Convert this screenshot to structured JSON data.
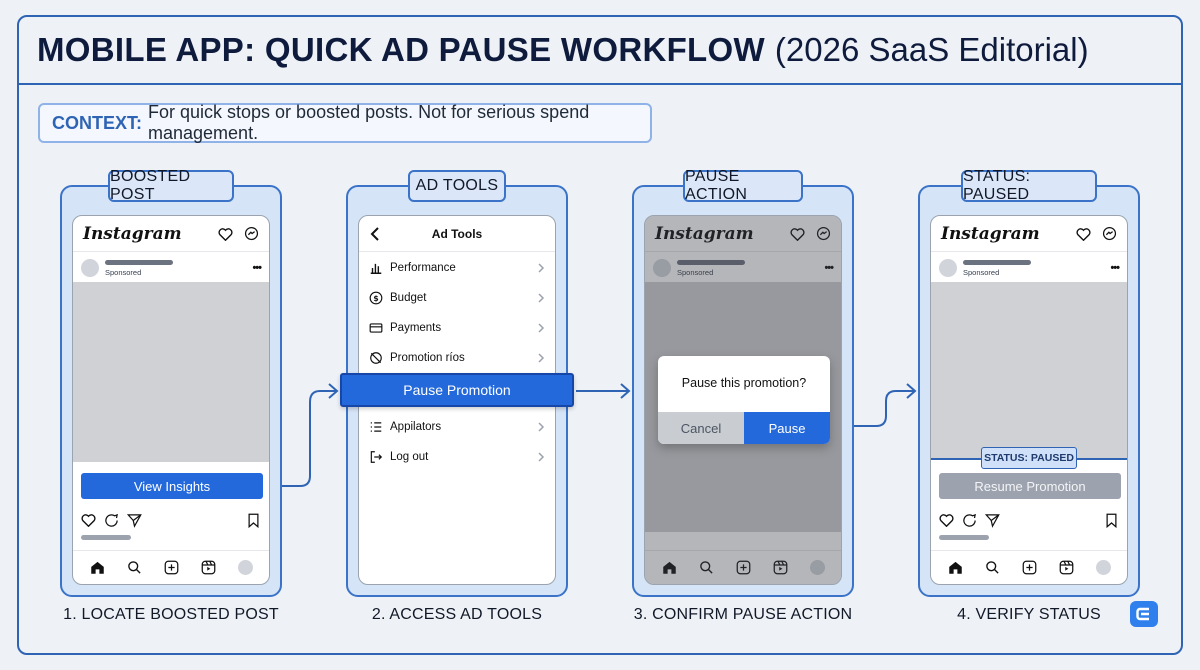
{
  "title": {
    "main": "MOBILE APP: QUICK AD PAUSE WORKFLOW",
    "sub": "(2026 SaaS Editorial)"
  },
  "context": {
    "label": "CONTEXT:",
    "text": "For quick stops or boosted posts. Not for serious spend management."
  },
  "steps": [
    {
      "tag": "BOOSTED POST",
      "caption": "1. LOCATE BOOSTED POST"
    },
    {
      "tag": "AD TOOLS",
      "caption": "2. ACCESS AD TOOLS"
    },
    {
      "tag": "PAUSE ACTION",
      "caption": "3. CONFIRM PAUSE ACTION"
    },
    {
      "tag": "STATUS: PAUSED",
      "caption": "4. VERIFY STATUS"
    }
  ],
  "phone": {
    "logo": "Instagram",
    "sponsored": "Sponsored",
    "more": "•••"
  },
  "step1": {
    "button": "View Insights"
  },
  "step2": {
    "header": "Ad Tools",
    "menu": [
      {
        "label": "Performance",
        "icon": "bar-chart-icon"
      },
      {
        "label": "Budget",
        "icon": "dollar-icon"
      },
      {
        "label": "Payments",
        "icon": "card-icon"
      },
      {
        "label": "Promotion ríos",
        "icon": "promotion-icon"
      },
      {
        "label": "Appilators",
        "icon": "list-icon"
      },
      {
        "label": "Log out",
        "icon": "logout-icon"
      }
    ],
    "highlight": "Pause Promotion"
  },
  "step3": {
    "question": "Pause this promotion?",
    "cancel": "Cancel",
    "confirm": "Pause"
  },
  "step4": {
    "badge": "STATUS: PAUSED",
    "button": "Resume Promotion"
  },
  "colors": {
    "accent": "#2469dc",
    "border": "#2f64b4",
    "panel": "#d6e4f7"
  }
}
